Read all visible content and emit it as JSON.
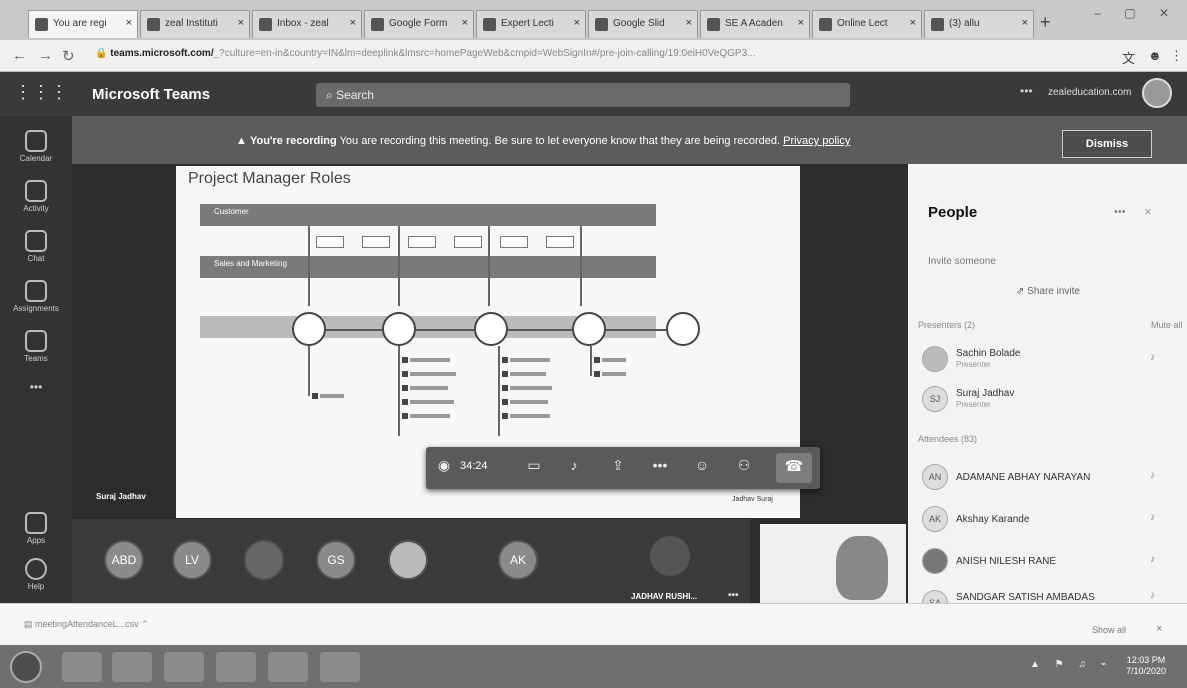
{
  "browser": {
    "tabs": [
      {
        "label": "You are regi"
      },
      {
        "label": "zeal Instituti"
      },
      {
        "label": "Inbox - zeal"
      },
      {
        "label": "Google Form"
      },
      {
        "label": "Expert Lecti"
      },
      {
        "label": "Google Slid"
      },
      {
        "label": "SE A Acaden"
      },
      {
        "label": "Online Lect"
      },
      {
        "label": "(3) allu"
      }
    ],
    "url_host": "teams.microsoft.com/",
    "url_rest": "_?culture=en-in&country=IN&lm=deeplink&lmsrc=homePageWeb&cmpid=WebSignIn#/pre-join-calling/19:0eiH0VeQGP3...",
    "new_tab": "+"
  },
  "teams": {
    "app_title": "Microsoft Teams",
    "search_placeholder": "Search",
    "org": "zealeducation.com",
    "more": "•••"
  },
  "rail": [
    {
      "label": "Calendar",
      "icon": "calendar-icon"
    },
    {
      "label": "Activity",
      "icon": "bell-icon"
    },
    {
      "label": "Chat",
      "icon": "chat-icon"
    },
    {
      "label": "Assignments",
      "icon": "assignments-icon"
    },
    {
      "label": "Teams",
      "icon": "teams-icon"
    },
    {
      "label": "•••",
      "icon": "more-icon"
    },
    {
      "label": "Apps",
      "icon": "apps-icon"
    },
    {
      "label": "Help",
      "icon": "help-icon"
    }
  ],
  "banner": {
    "bold": "You're recording",
    "text": " You are recording this meeting. Be sure to let everyone know that they are being recorded.",
    "link": "Privacy policy",
    "dismiss": "Dismiss"
  },
  "slide": {
    "title": "Project Manager Roles",
    "band1": "Customer",
    "band2": "Sales and Marketing",
    "presenter_caption": "Jadhav Suraj"
  },
  "stage": {
    "presenter_label": "Suraj Jadhav"
  },
  "controls": {
    "timer": "34:24"
  },
  "gallery": {
    "avatars": [
      "ABD",
      "LV",
      "",
      "GS",
      "",
      "AK",
      ""
    ],
    "name_label": "JADHAV RUSHI...",
    "more": "•••"
  },
  "people": {
    "title": "People",
    "more": "•••",
    "close": "×",
    "invite_placeholder": "Invite someone",
    "share_invite": "Share invite",
    "presenters_header": "Presenters (2)",
    "mute_all": "Mute all",
    "presenters": [
      {
        "name": "Sachin Bolade",
        "role": "Presenter",
        "initials": ""
      },
      {
        "name": "Suraj Jadhav",
        "role": "Presenter",
        "initials": "SJ"
      }
    ],
    "attendees_header": "Attendees (83)",
    "attendees": [
      {
        "name": "ADAMANE ABHAY NARAYAN",
        "initials": "AN"
      },
      {
        "name": "Akshay Karande",
        "initials": "AK"
      },
      {
        "name": "ANISH NILESH RANE",
        "initials": ""
      },
      {
        "name": "SANDGAR SATISH AMBADAS",
        "initials": "SA"
      }
    ]
  },
  "downloads": {
    "file": "meetingAttendanceL...csv",
    "show_all": "Show all",
    "close": "×"
  },
  "taskbar": {
    "clock_time": "12:03 PM",
    "clock_date": "7/10/2020"
  }
}
